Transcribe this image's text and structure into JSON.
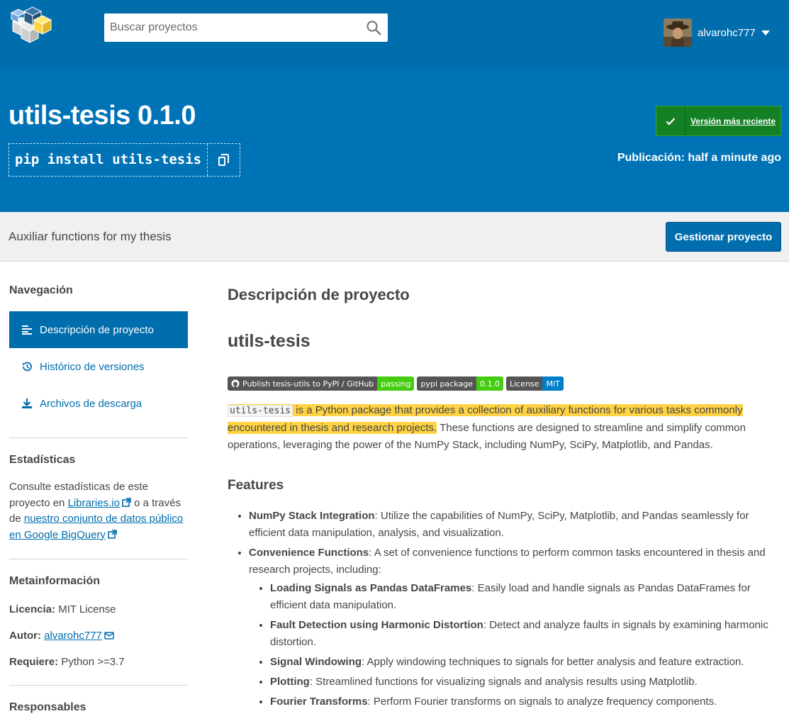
{
  "header": {
    "search_placeholder": "Buscar proyectos",
    "username": "alvarohc777"
  },
  "package": {
    "title": "utils-tesis 0.1.0",
    "pip_command": "pip install utils-tesis",
    "latest_label": "Versión más reciente",
    "released": "Publicación: half a minute ago",
    "summary": "Auxiliar functions for my thesis",
    "manage_label": "Gestionar proyecto"
  },
  "sidebar": {
    "nav_heading": "Navegación",
    "nav_items": [
      {
        "label": "Descripción de proyecto",
        "icon": "align-left-icon",
        "active": true
      },
      {
        "label": "Histórico de versiones",
        "icon": "history-icon",
        "active": false
      },
      {
        "label": "Archivos de descarga",
        "icon": "download-icon",
        "active": false
      }
    ],
    "stats_heading": "Estadísticas",
    "stats_text_1": "Consulte estadísticas de este proyecto en ",
    "stats_link_1": "Libraries.io",
    "stats_text_2": " o a través de ",
    "stats_link_2": "nuestro conjunto de datos público en Google BigQuery",
    "meta_heading": "Metainformación",
    "license_label": "Licencia:",
    "license_value": "MIT License",
    "author_label": "Autor:",
    "author_value": "alvarohc777",
    "requires_label": "Requiere:",
    "requires_value": "Python >=3.7",
    "maintainers_heading": "Responsables"
  },
  "main": {
    "section_title": "Descripción de proyecto",
    "readme_title": "utils-tesis",
    "badges": [
      {
        "left": "Publish tesis-utils to PyPI / GitHub",
        "right": "passing",
        "color": "green"
      },
      {
        "left": "pypi package",
        "right": "0.1.0",
        "color": "green"
      },
      {
        "left": "License",
        "right": "MIT",
        "color": "blue"
      }
    ],
    "intro_code": "utils-tesis",
    "intro_highlight": " is a Python package that provides a collection of auxiliary functions for various tasks commonly encountered in thesis and research projects.",
    "intro_rest": " These functions are designed to streamline and simplify common operations, leveraging the power of the NumPy Stack, including NumPy, SciPy, Matplotlib, and Pandas.",
    "features_heading": "Features",
    "features": [
      {
        "title": "NumPy Stack Integration",
        "text": ": Utilize the capabilities of NumPy, SciPy, Matplotlib, and Pandas seamlessly for efficient data manipulation, analysis, and visualization."
      },
      {
        "title": "Convenience Functions",
        "text": ": A set of convenience functions to perform common tasks encountered in thesis and research projects, including:"
      }
    ],
    "sub_features": [
      {
        "title": "Loading Signals as Pandas DataFrames",
        "text": ": Easily load and handle signals as Pandas DataFrames for efficient data manipulation."
      },
      {
        "title": "Fault Detection using Harmonic Distortion",
        "text": ": Detect and analyze faults in signals by examining harmonic distortion."
      },
      {
        "title": "Signal Windowing",
        "text": ": Apply windowing techniques to signals for better analysis and feature extraction."
      },
      {
        "title": "Plotting",
        "text": ": Streamlined functions for visualizing signals and analysis results using Matplotlib."
      },
      {
        "title": "Fourier Transforms",
        "text": ": Perform Fourier transforms on signals to analyze frequency components."
      }
    ]
  },
  "colors": {
    "brand_blue": "#006dad",
    "hero_blue": "#0073b7",
    "latest_green": "#148024",
    "highlight_yellow": "#ffd343"
  }
}
